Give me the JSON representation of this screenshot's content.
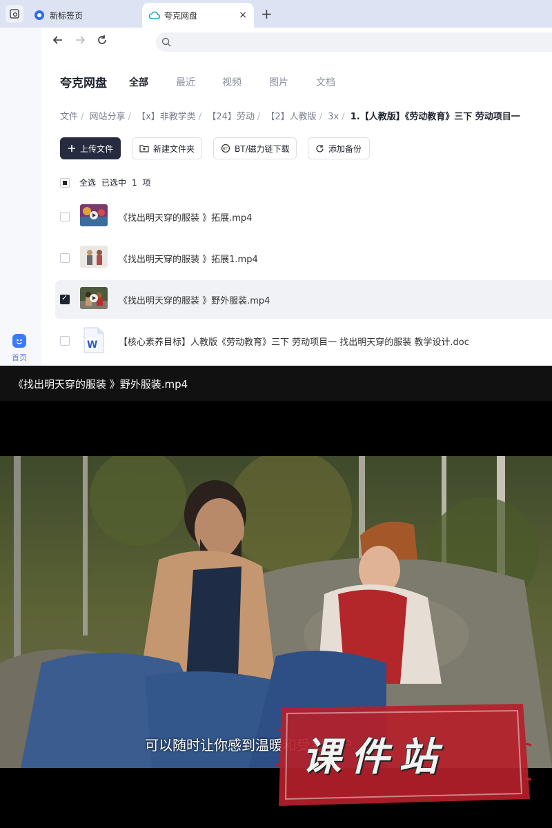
{
  "browser": {
    "tabs": [
      {
        "label": "新标签页",
        "active": false
      },
      {
        "label": "夸克网盘",
        "active": true
      }
    ],
    "close_symbol": "×",
    "new_tab_symbol": "+",
    "address": ""
  },
  "rail": {
    "home_label": "首页"
  },
  "header": {
    "brand": "夸克网盘",
    "categories": [
      "全部",
      "最近",
      "视频",
      "图片",
      "文档"
    ],
    "active_category": "全部"
  },
  "breadcrumb": [
    "文件",
    "网站分享",
    "【x】非教学类",
    "【24】劳动",
    "【2】人教版",
    "3x",
    "1.【人教版】《劳动教育》三下 劳动项目一"
  ],
  "breadcrumb_sep": "/",
  "toolbar": {
    "upload": "上传文件",
    "new_folder": "新建文件夹",
    "bt": "BT/磁力链下载",
    "backup": "添加备份"
  },
  "selection": {
    "select_all": "全选",
    "selected_prefix": "已选中",
    "count": "1",
    "unit": "项"
  },
  "files": [
    {
      "name": "《找出明天穿的服装 》拓展.mp4",
      "checked": false
    },
    {
      "name": "《找出明天穿的服装 》拓展1.mp4",
      "checked": false
    },
    {
      "name": "《找出明天穿的服装 》野外服装.mp4",
      "checked": true
    },
    {
      "name": "【核心素养目标】人教版《劳动教育》三下 劳动项目一 找出明天穿的服装 教学设计.doc",
      "checked": false
    }
  ],
  "player": {
    "title": "《找出明天穿的服装 》野外服装.mp4",
    "subtitle": "可以随时让你感到温暖和受到保护"
  },
  "watermark": "课件站",
  "colors": {
    "accent": "#262b40",
    "tabbar": "#dde3f3",
    "stamp_red": "#b51f2a"
  }
}
